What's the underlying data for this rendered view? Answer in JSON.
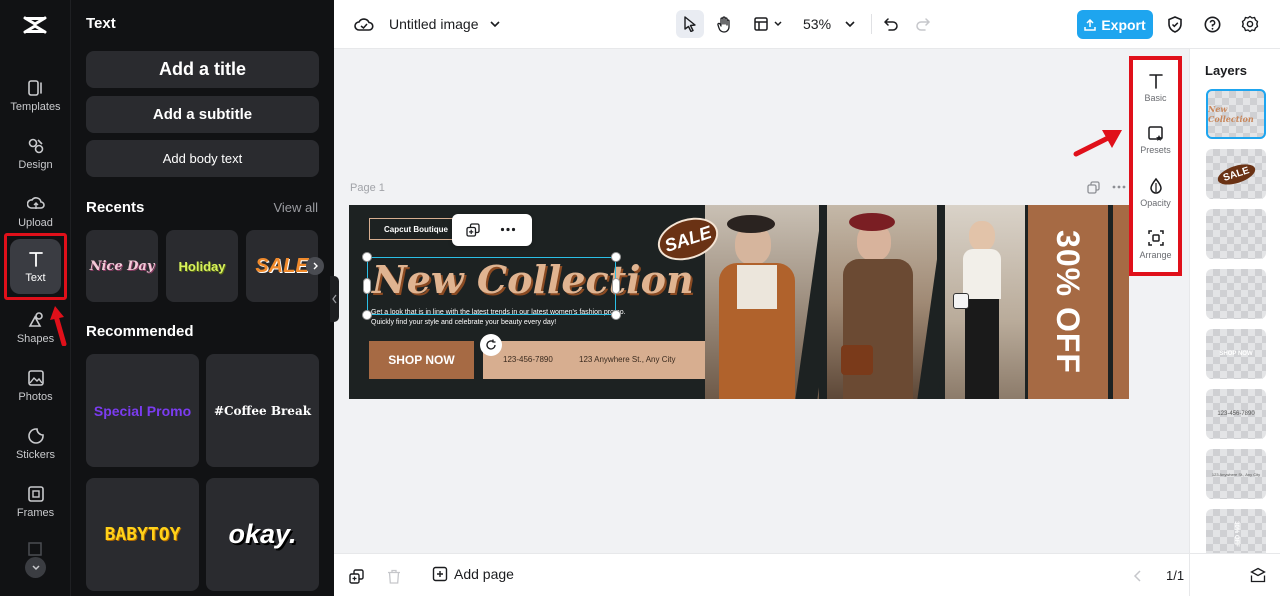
{
  "rail": {
    "items": [
      {
        "label": "Templates",
        "icon": "templates-icon"
      },
      {
        "label": "Design",
        "icon": "design-icon"
      },
      {
        "label": "Upload",
        "icon": "upload-icon"
      },
      {
        "label": "Text",
        "icon": "text-icon"
      },
      {
        "label": "Shapes",
        "icon": "shapes-icon"
      },
      {
        "label": "Photos",
        "icon": "photos-icon"
      },
      {
        "label": "Stickers",
        "icon": "stickers-icon"
      },
      {
        "label": "Frames",
        "icon": "frames-icon"
      }
    ]
  },
  "panel": {
    "title": "Text",
    "add_title": "Add a title",
    "add_subtitle": "Add a subtitle",
    "add_body": "Add body text",
    "recents_title": "Recents",
    "view_all": "View all",
    "recents": [
      "Nice Day",
      "Holiday",
      "SALE"
    ],
    "recommended_title": "Recommended",
    "recommended": [
      "Special Promo",
      "#Coffee Break",
      "BABYTOY",
      "okay."
    ]
  },
  "topbar": {
    "doc_title": "Untitled image",
    "zoom": "53%",
    "export_label": "Export"
  },
  "canvas": {
    "page_label": "Page 1",
    "brand": "Capcut Boutique",
    "headline": "New Collection",
    "body_line1": "Get a look that is in line with the latest trends in our latest women's fashion promo.",
    "body_line2": "Quickly find your style and celebrate your beauty every day!",
    "cta": "SHOP NOW",
    "phone": "123-456-7890",
    "address": "123 Anywhere St., Any City",
    "sale_tag": "SALE",
    "discount": "30% OFF"
  },
  "props": {
    "basic": "Basic",
    "presets": "Presets",
    "opacity": "Opacity",
    "arrange": "Arrange"
  },
  "layers": {
    "title": "Layers",
    "thumbs": [
      "New Collection",
      "SALE",
      "",
      "",
      "SHOP NOW",
      "123-456-7890",
      "123 Anywhere St., Any City",
      "30% OFF"
    ]
  },
  "bottombar": {
    "add_page": "Add page",
    "page_count": "1/1"
  },
  "colors": {
    "accent": "#1ea5ef",
    "highlight": "#e0101a",
    "banner_bg": "#1d2222",
    "brown": "#a66a44",
    "tan": "#d7ae90"
  }
}
